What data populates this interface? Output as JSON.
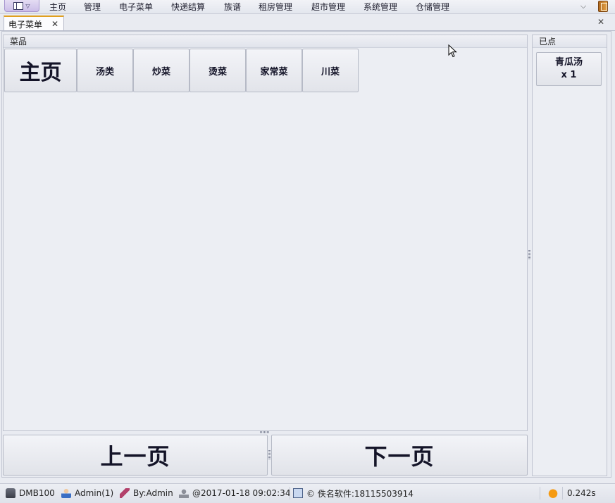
{
  "menubar": {
    "items": [
      "主页",
      "管理",
      "电子菜单",
      "快递结算",
      "族谱",
      "租房管理",
      "超市管理",
      "系统管理",
      "仓储管理"
    ]
  },
  "tabs": [
    {
      "label": "电子菜单",
      "close": "✕"
    }
  ],
  "close_all": "✕",
  "dishes_panel": {
    "title": "菜品",
    "categories": [
      "主页",
      "汤类",
      "炒菜",
      "烫菜",
      "家常菜",
      "川菜"
    ]
  },
  "ordered_panel": {
    "title": "已点",
    "items": [
      {
        "name": "青瓜汤",
        "qty": "x 1"
      }
    ]
  },
  "pager": {
    "prev": "上一页",
    "next": "下一页"
  },
  "statusbar": {
    "db": "DMB100",
    "user": "Admin(1)",
    "by": "By:Admin",
    "datetime": "@2017-01-18 09:02:34",
    "copyright": "© 佚名软件:18115503914",
    "elapsed": "0.242s"
  },
  "colors": {
    "tab_accent": "#e0a020",
    "app_button": "#cbbde8"
  }
}
